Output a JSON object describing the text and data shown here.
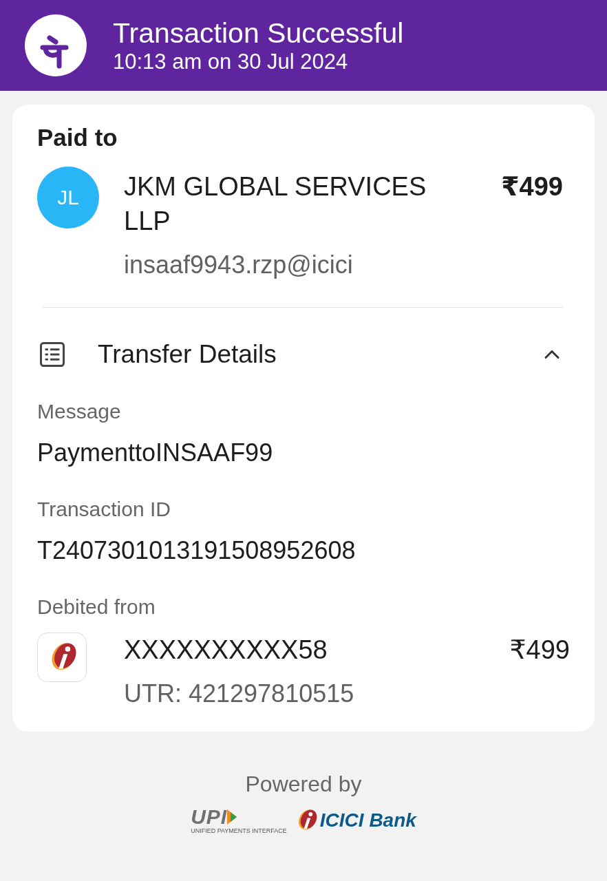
{
  "header": {
    "title": "Transaction Successful",
    "timestamp": "10:13 am on 30 Jul 2024"
  },
  "paid_to": {
    "heading": "Paid to",
    "avatar_initials": "JL",
    "name": "JKM GLOBAL SERVICES LLP",
    "amount": "₹499",
    "upi_id": "insaaf9943.rzp@icici"
  },
  "transfer_details": {
    "title": "Transfer Details",
    "expanded": true,
    "fields": [
      {
        "label": "Message",
        "value": "PaymenttoINSAAF99"
      },
      {
        "label": "Transaction ID",
        "value": "T2407301013191508952608"
      }
    ],
    "debited_from": {
      "label": "Debited from",
      "account": "XXXXXXXXXX58",
      "amount": "₹499",
      "utr": "UTR: 421297810515"
    }
  },
  "footer": {
    "powered_by": "Powered by",
    "upi_logo": "UPI",
    "upi_tagline": "UNIFIED PAYMENTS INTERFACE",
    "bank_logo": "ICICI Bank"
  }
}
